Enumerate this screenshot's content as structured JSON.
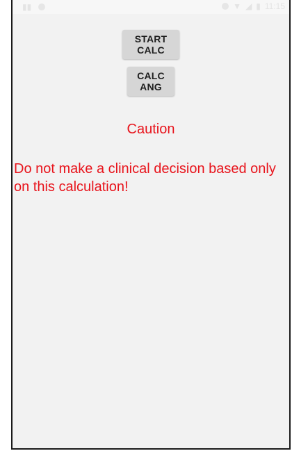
{
  "status_bar": {
    "time": "11:15"
  },
  "buttons": {
    "start_calc": "START CALC",
    "calc_ang": "CALC ANG"
  },
  "warning": {
    "title": "Caution",
    "message": "Do not make a clinical decision based only on this calculation!"
  },
  "colors": {
    "warning_text": "#e8141c",
    "button_bg": "#d6d6d6",
    "screen_bg": "#f2f2f2"
  }
}
